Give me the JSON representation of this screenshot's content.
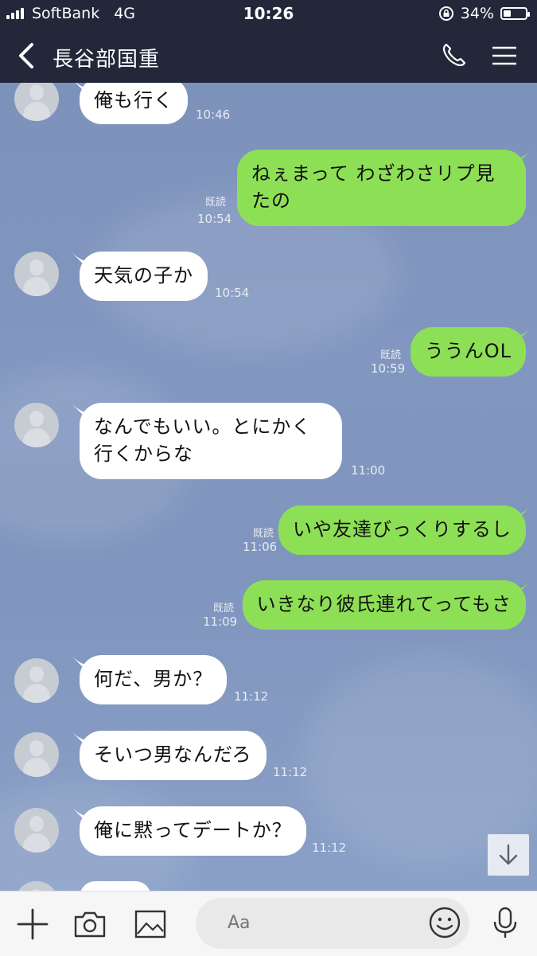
{
  "status_bar": {
    "carrier": "SoftBank",
    "network": "4G",
    "time": "10:26",
    "battery": "34%",
    "battery_level": 0.34
  },
  "header": {
    "title": "長谷部国重",
    "back_icon": "chevron-left-icon",
    "call_icon": "phone-icon",
    "menu_icon": "hamburger-menu-icon"
  },
  "messages": [
    {
      "side": "in",
      "text": "俺も行く",
      "time": "10:46"
    },
    {
      "side": "out",
      "text": "ねぇまって わざわさリプ見たの",
      "time": "10:54",
      "read": "既読"
    },
    {
      "side": "in",
      "text": "天気の子か",
      "time": "10:54"
    },
    {
      "side": "out",
      "text": "ううんOL",
      "time": "10:59",
      "read": "既読"
    },
    {
      "side": "in",
      "text": "なんでもいい。とにかく行くからな",
      "time": "11:00"
    },
    {
      "side": "out",
      "text": "いや友達びっくりするし",
      "time": "11:06",
      "read": "既読"
    },
    {
      "side": "out",
      "text": "いきなり彼氏連れてってもさ",
      "time": "11:09",
      "read": "既読"
    },
    {
      "side": "in",
      "text": "何だ、男か？",
      "time": "11:12"
    },
    {
      "side": "in",
      "text": "そいつ男なんだろ",
      "time": "11:12"
    },
    {
      "side": "in",
      "text": "俺に黙ってデートか？",
      "time": "11:12"
    }
  ],
  "composer": {
    "placeholder": "Aa",
    "plus_icon": "plus-icon",
    "camera_icon": "camera-icon",
    "image_icon": "image-icon",
    "emoji_icon": "emoji-icon",
    "mic_icon": "microphone-icon"
  },
  "colors": {
    "header_bg": "#22283a",
    "outgoing_bubble": "#8de055",
    "incoming_bubble": "#ffffff",
    "chat_bg": "#8096bd"
  }
}
